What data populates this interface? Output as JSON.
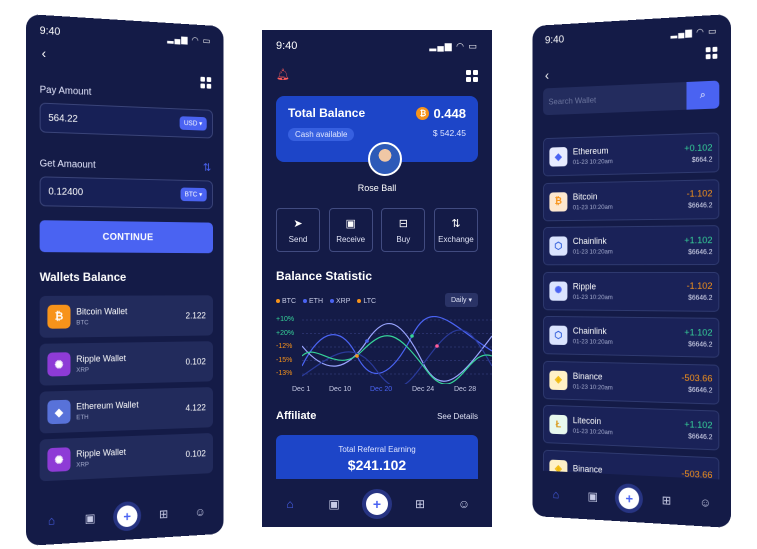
{
  "status": {
    "time_left": "9:40",
    "time_center": "9:40",
    "time_right": "9:40"
  },
  "left": {
    "pay_label": "Pay Amount",
    "pay_value": "564.22",
    "pay_currency": "USD",
    "get_label": "Get Amaount",
    "get_value": "0.12400",
    "get_currency": "BTC",
    "continue_label": "CONTINUE",
    "wallets_title": "Wallets Balance",
    "wallets": [
      {
        "name": "Bitcoin Wallet",
        "symbol": "BTC",
        "value": "2.122",
        "color": "#f7931a",
        "glyph": "₿"
      },
      {
        "name": "Ripple Wallet",
        "symbol": "XRP",
        "value": "0.102",
        "color": "#8e3bd6",
        "glyph": "✺"
      },
      {
        "name": "Ethereum Wallet",
        "symbol": "ETH",
        "value": "4.122",
        "color": "#5872d9",
        "glyph": "◆"
      },
      {
        "name": "Ripple Wallet",
        "symbol": "XRP",
        "value": "0.102",
        "color": "#8e3bd6",
        "glyph": "✺"
      }
    ]
  },
  "center": {
    "total_title": "Total Balance",
    "cash_label": "Cash available",
    "btc_value": "0.448",
    "usd_value": "$ 542.45",
    "user_name": "Rose Ball",
    "actions": [
      {
        "label": "Send",
        "icon": "send-icon",
        "glyph": "➤"
      },
      {
        "label": "Receive",
        "icon": "wallet-icon",
        "glyph": "▣"
      },
      {
        "label": "Buy",
        "icon": "cart-icon",
        "glyph": "⊟"
      },
      {
        "label": "Exchange",
        "icon": "exchange-icon",
        "glyph": "⇅"
      }
    ],
    "stats_title": "Balance Statistic",
    "legend": [
      {
        "label": "BTC",
        "color": "#f7931a"
      },
      {
        "label": "ETH",
        "color": "#4a63f2"
      },
      {
        "label": "XRP",
        "color": "#4a63f2"
      },
      {
        "label": "LTC",
        "color": "#f7931a"
      }
    ],
    "period": "Daily",
    "yticks": [
      {
        "label": "+10%",
        "color": "#36d399"
      },
      {
        "label": "+20%",
        "color": "#36d399"
      },
      {
        "label": "-12%",
        "color": "#f7931a"
      },
      {
        "label": "-15%",
        "color": "#f7931a"
      },
      {
        "label": "-13%",
        "color": "#f7931a"
      }
    ],
    "xticks": [
      "Dec 1",
      "Dec 10",
      "Dec 20",
      "Dec 24",
      "Dec 28"
    ],
    "affiliate_title": "Affiliate",
    "see_details": "See Details",
    "referral_label": "Total Referral Earning",
    "referral_value": "$241.102"
  },
  "right": {
    "search_placeholder": "Search Wallet",
    "coins": [
      {
        "name": "Ethereum",
        "date": "01-23 10:20am",
        "change": "+0.102",
        "value": "$664.2",
        "up": true,
        "color": "#e8ecff",
        "fg": "#4a63f2",
        "glyph": "◆"
      },
      {
        "name": "Bitcoin",
        "date": "01-23 10:20am",
        "change": "-1.102",
        "value": "$6646.2",
        "up": false,
        "color": "#fde7cf",
        "fg": "#f7931a",
        "glyph": "₿"
      },
      {
        "name": "Chainlink",
        "date": "01-23 10:20am",
        "change": "+1.102",
        "value": "$6646.2",
        "up": true,
        "color": "#dbe4ff",
        "fg": "#2a5ada",
        "glyph": "⬡"
      },
      {
        "name": "Ripple",
        "date": "01-23 10:20am",
        "change": "-1.102",
        "value": "$6646.2",
        "up": false,
        "color": "#dbe4ff",
        "fg": "#4a63f2",
        "glyph": "✺"
      },
      {
        "name": "Chainlink",
        "date": "01-23 10:20am",
        "change": "+1.102",
        "value": "$6646.2",
        "up": true,
        "color": "#dbe4ff",
        "fg": "#2a5ada",
        "glyph": "⬡"
      },
      {
        "name": "Binance",
        "date": "01-23 10:20am",
        "change": "-503.66",
        "value": "$6646.2",
        "up": false,
        "color": "#fff1c7",
        "fg": "#f0b90b",
        "glyph": "◈"
      },
      {
        "name": "Litecoin",
        "date": "01-23 10:20am",
        "change": "+1.102",
        "value": "$6646.2",
        "up": true,
        "color": "#e7f8ee",
        "fg": "#d99b1f",
        "glyph": "Ł"
      },
      {
        "name": "Binance",
        "date": "",
        "change": "-503.66",
        "value": "",
        "up": false,
        "color": "#fff1c7",
        "fg": "#f0b90b",
        "glyph": "◈"
      }
    ]
  },
  "colors": {
    "bg": "#141b47",
    "accent": "#4a63f2",
    "up": "#36d399",
    "down": "#f7931a"
  }
}
